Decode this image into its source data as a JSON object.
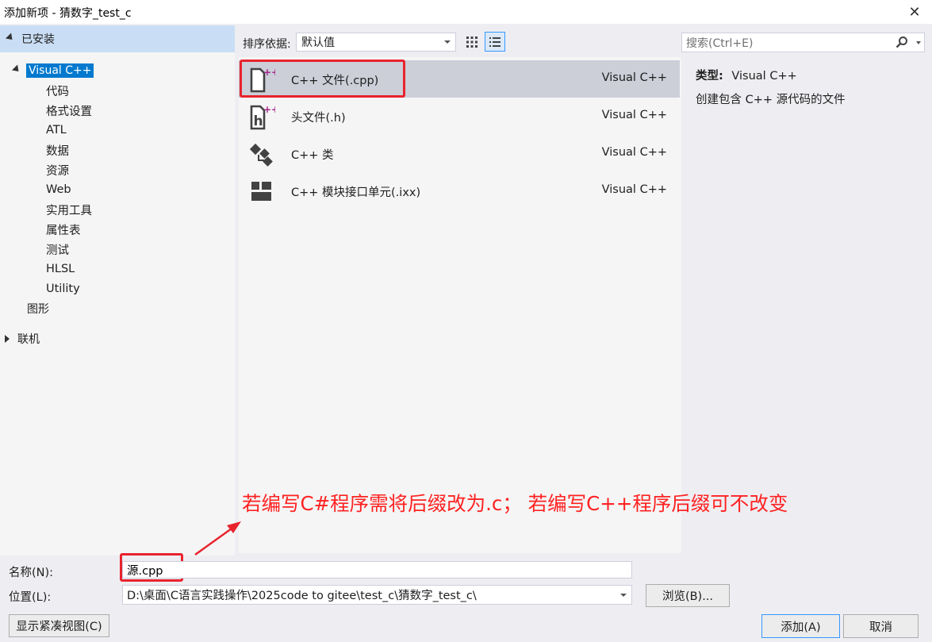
{
  "window": {
    "title": "添加新项 - 猜数字_test_c",
    "close_glyph": "✕"
  },
  "tree": {
    "installed": "已安装",
    "selected": "Visual C++",
    "children": [
      "代码",
      "格式设置",
      "ATL",
      "数据",
      "资源",
      "Web",
      "实用工具",
      "属性表",
      "测试",
      "HLSL",
      "Utility"
    ],
    "graphics": "图形",
    "online": "联机"
  },
  "toolbar": {
    "sort_label": "排序依据:",
    "sort_value": "默认值",
    "search_placeholder": "搜索(Ctrl+E)"
  },
  "templates": [
    {
      "name": "C++ 文件(.cpp)",
      "type": "Visual C++",
      "icon": "cpp-file-icon",
      "selected": true
    },
    {
      "name": "头文件(.h)",
      "type": "Visual C++",
      "icon": "header-file-icon",
      "selected": false
    },
    {
      "name": "C++ 类",
      "type": "Visual C++",
      "icon": "cpp-class-icon",
      "selected": false
    },
    {
      "name": "C++ 模块接口单元(.ixx)",
      "type": "Visual C++",
      "icon": "module-icon",
      "selected": false
    }
  ],
  "details": {
    "type_label": "类型:",
    "type_value": "Visual C++",
    "description": "创建包含 C++ 源代码的文件"
  },
  "annotation": {
    "note": "若编写C#程序需将后缀改为.c； 若编写C++程序后缀可不改变",
    "color": "#e8232d"
  },
  "form": {
    "name_label": "名称(N):",
    "name_value": "源.cpp",
    "location_label": "位置(L):",
    "location_value": "D:\\桌面\\C语言实践操作\\2025code to gitee\\test_c\\猜数字_test_c\\",
    "browse_label": "浏览(B)..."
  },
  "buttons": {
    "compact_view": "显示紧凑视图(C)",
    "add": "添加(A)",
    "cancel": "取消"
  },
  "colors": {
    "selection": "#0079ce",
    "accent": "#3399ff",
    "magenta": "#a3278c"
  }
}
